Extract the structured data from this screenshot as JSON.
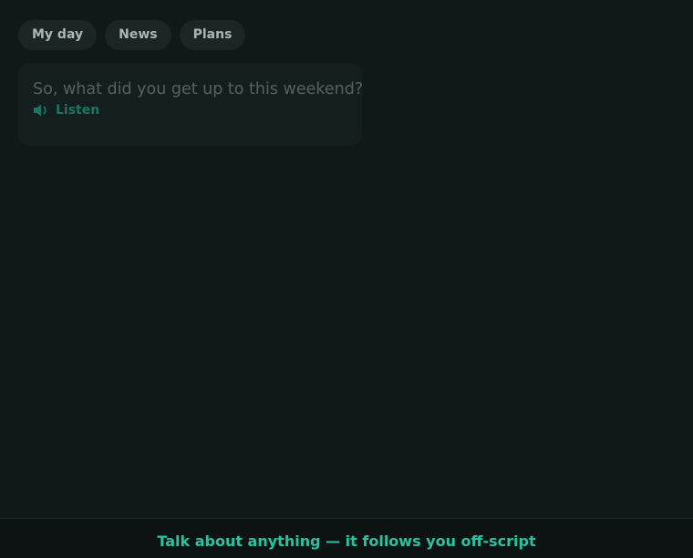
{
  "topics": [
    {
      "label": "My day"
    },
    {
      "label": "News"
    },
    {
      "label": "Plans"
    }
  ],
  "message": {
    "text": "So, what did you get up to this weekend?",
    "listen_label": "Listen",
    "listen_icon": "speaker-icon"
  },
  "footer": {
    "text": "Talk about anything — it follows you off-script"
  },
  "colors": {
    "background": "#111818",
    "accent": "#2cc2a1",
    "listen": "#1b7560"
  }
}
